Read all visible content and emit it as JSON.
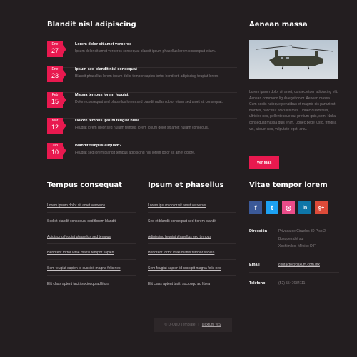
{
  "events_section": {
    "title": "Blandit nisl adipiscing",
    "items": [
      {
        "month": "Ene",
        "day": "27",
        "title": "Lorem dolor sit amet veroeros",
        "text": "Ipsum dolor sit amet veroeros consequat blandit ipsum phasellus lorem consequat etiam."
      },
      {
        "month": "Ene",
        "day": "23",
        "title": "Ipsum sed blandit nisl consequat",
        "text": "Blandit phasellus lorem ipsum dolor tempor sapien tortor hendrerit adipiscing feugiat lorem."
      },
      {
        "month": "Feb",
        "day": "15",
        "title": "Magna tempus lorem feugiat",
        "text": "Dolore consequat sed phasellus lorem sed blandit nullam dolor etiam sed amet sit consequat."
      },
      {
        "month": "Mar",
        "day": "12",
        "title": "Dolore tempus ipsum feugiat nulla",
        "text": "Feugiat lorem dolor sed nullam tempus lorem ipsum dolor sit amet nullam consequat."
      },
      {
        "month": "Jun",
        "day": "10",
        "title": "Blandit tempus aliquam?",
        "text": "Feugiat sed lorem blandit tempus adipiscing nisl lorem dolor sit amet dolore."
      }
    ]
  },
  "about": {
    "title": "Aenean massa",
    "text": "Lorem ipsum dolor sit amet, consectetuer adipiscing elit. Aenean commodo ligula eget dolor. Aenean massa. Cum sociis natoque penatibus et magnis dis parturient montes, nascetur ridiculus mus. Donec quam felis, ultricies nec, pellentesque eu, pretium quis, sem. Nulla consequat massa quis enim. Donec pede justo, fringilla vel, aliquet nec, vulputate eget, arcu.",
    "button": "Ver Más",
    "image_alt": "helicopter"
  },
  "links_a": {
    "title": "Tempus consequat",
    "items": [
      "Lorem ipsum dolor sit amet veroeros",
      "Sed et blandit consequat sed tlorem blandit",
      "Adipiscing feugiat phasellus sed tempus",
      "Hendrerit tortor vitae mattis tempor sapien",
      "Sem feugiat sapien id suscipit magna felis nec",
      "Elit class aptent taciti sociosqu ad litora"
    ]
  },
  "links_b": {
    "title": "Ipsum et phasellus",
    "items": [
      "Lorem ipsum dolor sit amet veroeros",
      "Sed et blandit consequat sed tlorem blandit",
      "Adipiscing feugiat phasellus sed tempus",
      "Hendrerit tortor vitae mattis tempor sapien",
      "Sem feugiat sapien id suscipit magna felis nec",
      "Elit class aptent taciti sociosqu ad litora"
    ]
  },
  "contact": {
    "title": "Vitae tempor lorem",
    "social": [
      {
        "icon": "facebook-icon",
        "glyph": "f",
        "color": "#3b5998"
      },
      {
        "icon": "twitter-icon",
        "glyph": "t",
        "color": "#1da1f2"
      },
      {
        "icon": "dribbble-icon",
        "glyph": "◎",
        "color": "#ea4c89"
      },
      {
        "icon": "linkedin-icon",
        "glyph": "in",
        "color": "#0e76a8"
      },
      {
        "icon": "google-plus-icon",
        "glyph": "g+",
        "color": "#dd4b39"
      }
    ],
    "address_label": "Dirección",
    "address_value": [
      "Privada de Ciruelos 30 Piso 2,",
      "Bosques del sur",
      "Xochimilco, México D.F."
    ],
    "email_label": "Email",
    "email_value": "contacto@daxum.com.mx",
    "phone_label": "Teléfono",
    "phone_value": "(52) 5547684111"
  },
  "footer": {
    "copyright": "© D-ODD Template",
    "link": "Daxtum WS"
  }
}
